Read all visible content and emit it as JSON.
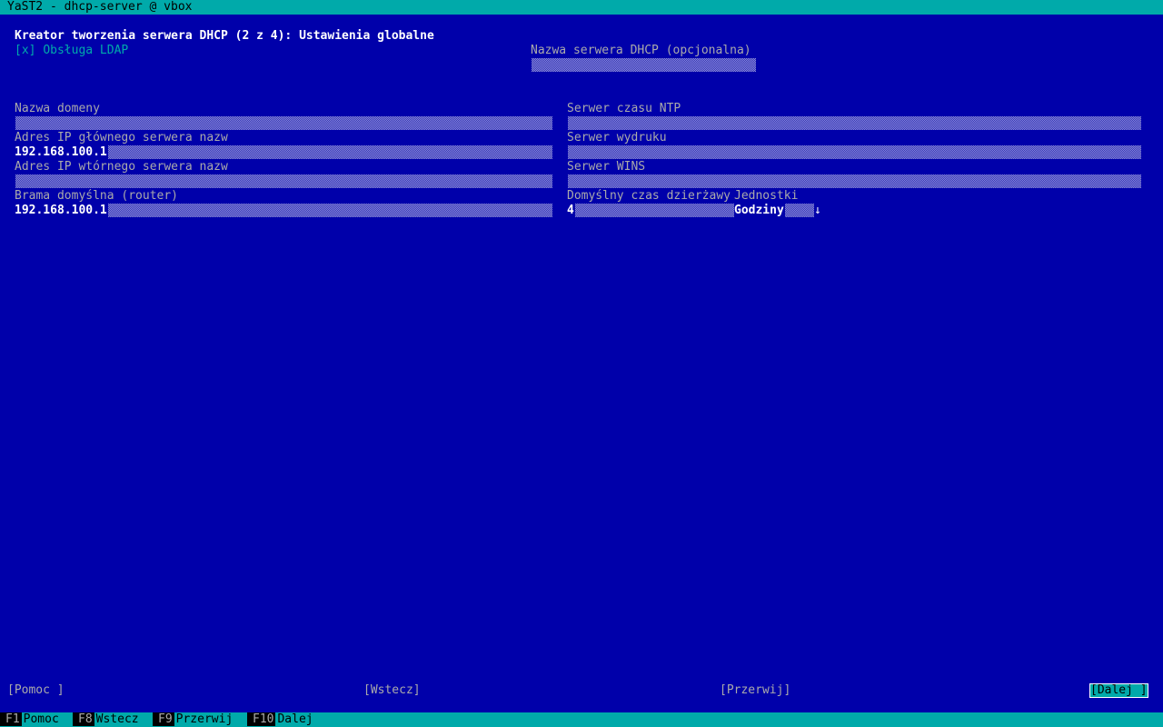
{
  "window": {
    "title": "YaST2 - dhcp-server @ vbox"
  },
  "dialog": {
    "heading": "Kreator tworzenia serwera DHCP (2 z 4): Ustawienia globalne",
    "ldap_checkbox": {
      "mark": "[x]",
      "label": "Obsługa LDAP",
      "checked": true
    },
    "dhcp_server_name": {
      "label": "Nazwa serwera DHCP (opcjonalna)",
      "value": ""
    }
  },
  "left_fields": {
    "domain_name": {
      "label": "Nazwa domeny",
      "value": ""
    },
    "primary_ns": {
      "label": "Adres IP głównego serwera nazw",
      "value": "192.168.100.1"
    },
    "secondary_ns": {
      "label": "Adres IP wtórnego serwera nazw",
      "value": ""
    },
    "gateway": {
      "label": "Brama domyślna (router)",
      "value": "192.168.100.1"
    }
  },
  "right_fields": {
    "ntp": {
      "label": "Serwer czasu NTP",
      "value": ""
    },
    "print": {
      "label": "Serwer wydruku",
      "value": ""
    },
    "wins": {
      "label": "Serwer WINS",
      "value": ""
    },
    "lease": {
      "label": "Domyślny czas dzierżawy",
      "value": "4"
    },
    "units": {
      "label": "Jednostki",
      "value": "Godziny",
      "arrow": "↓"
    }
  },
  "buttons": {
    "help": "[Pomoc ]",
    "back": "[Wstecz]",
    "abort": "[Przerwij]",
    "next": "[Dalej ]"
  },
  "fkeys": [
    {
      "key": "F1",
      "label": "Pomoc"
    },
    {
      "key": "F8",
      "label": "Wstecz"
    },
    {
      "key": "F9",
      "label": "Przerwij"
    },
    {
      "key": "F10",
      "label": "Dalej"
    }
  ]
}
